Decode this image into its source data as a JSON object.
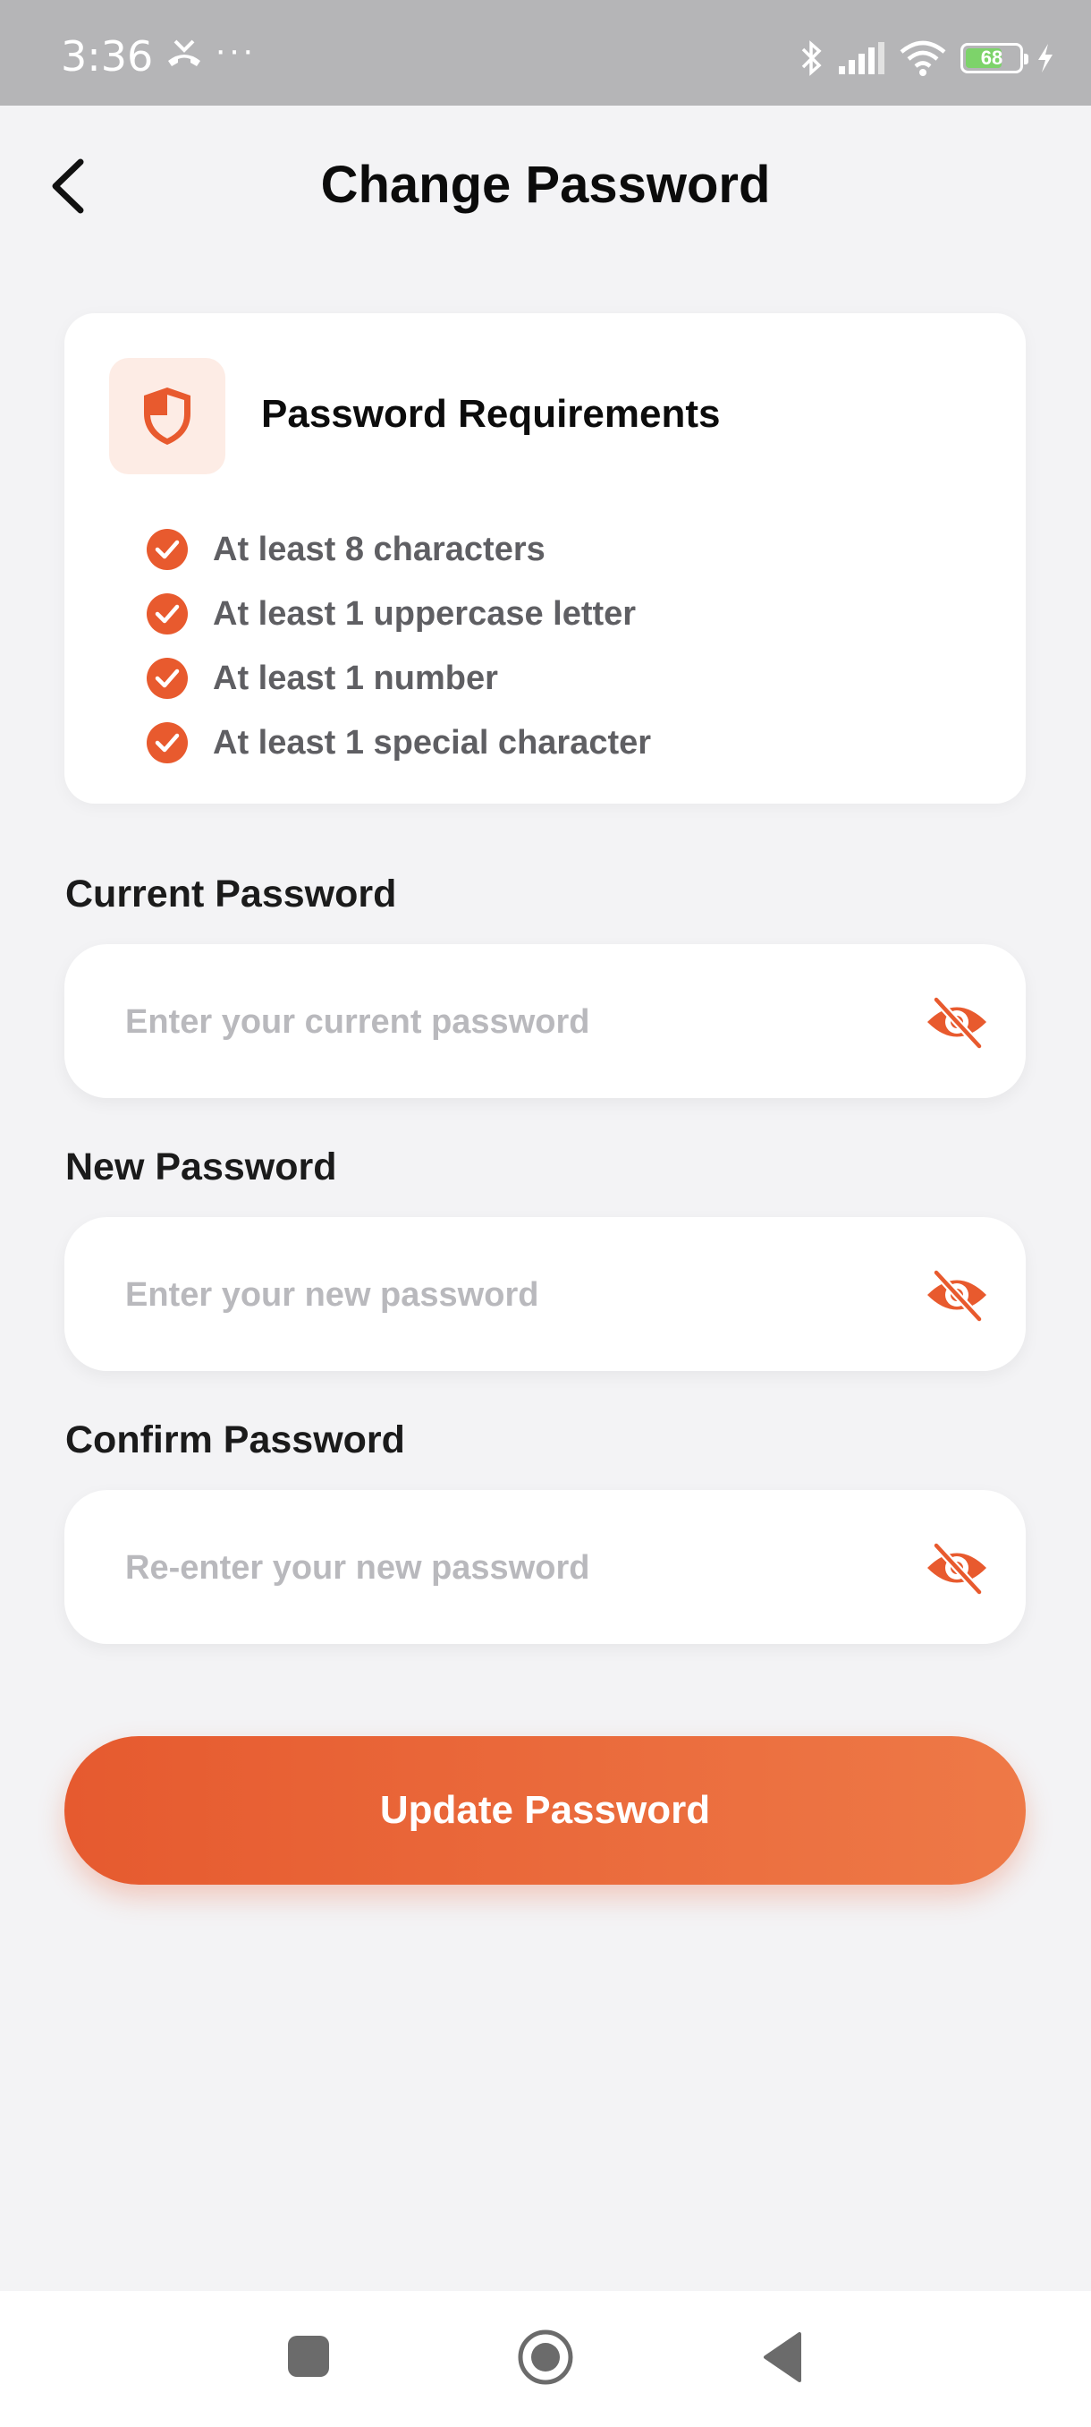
{
  "status_bar": {
    "time": "3:36",
    "dots": "···",
    "battery_level": "68",
    "icons": [
      "missed-call-icon",
      "bluetooth-icon",
      "signal-icon",
      "wifi-icon",
      "battery-icon",
      "charging-icon"
    ]
  },
  "header": {
    "title": "Change Password",
    "back_icon": "chevron-left-icon"
  },
  "requirements": {
    "title": "Password Requirements",
    "icon": "shield-icon",
    "items": [
      "At least 8 characters",
      "At least 1 uppercase letter",
      "At least 1 number",
      "At least 1 special character"
    ]
  },
  "fields": {
    "current": {
      "label": "Current Password",
      "placeholder": "Enter your current password",
      "value": ""
    },
    "new": {
      "label": "New Password",
      "placeholder": "Enter your new password",
      "value": ""
    },
    "confirm": {
      "label": "Confirm Password",
      "placeholder": "Re-enter your new password",
      "value": ""
    }
  },
  "submit": {
    "label": "Update Password"
  },
  "colors": {
    "accent": "#e85a2e",
    "accent_light": "#fdece5",
    "background": "#f3f3f5",
    "card": "#ffffff",
    "status_bar": "#b5b5b7"
  },
  "nav": {
    "icons": [
      "recents-icon",
      "home-icon",
      "back-icon"
    ]
  }
}
